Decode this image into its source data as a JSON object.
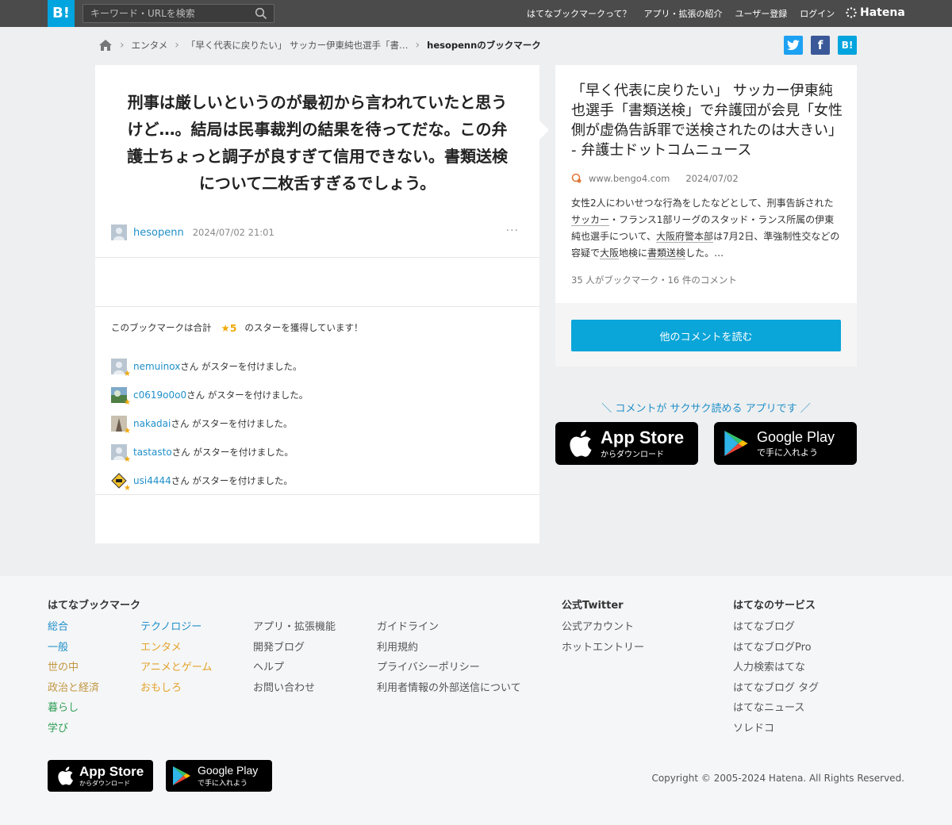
{
  "header": {
    "logo": "B!",
    "search_placeholder": "キーワード・URLを検索",
    "nav": [
      "はてなブックマークって？",
      "アプリ・拡張の紹介",
      "ユーザー登録",
      "ログイン"
    ],
    "brand": "Hatena"
  },
  "breadcrumb": {
    "items": [
      "エンタメ",
      "「早く代表に戻りたい」 サッカー伊東純也選手「書…"
    ],
    "current": "hesopennのブックマーク"
  },
  "share": {
    "facebook": "f",
    "hatena": "B!"
  },
  "bookmark": {
    "comment": "刑事は厳しいというのが最初から言われていたと思うけど…。結局は民事裁判の結果を待ってだな。この弁護士ちょっと調子が良すぎて信用できない。書類送検について二枚舌すぎるでしょう。",
    "user": "hesopenn",
    "timestamp": "2024/07/02 21:01",
    "more": "···"
  },
  "stars": {
    "summary_prefix": "このブックマークは合計",
    "total": "★5",
    "summary_suffix": "のスターを獲得しています！",
    "suffix": "さん がスターを付けました。",
    "users": [
      "nemuinox",
      "c0619o0o0",
      "nakadai",
      "tastasto",
      "usi4444"
    ]
  },
  "entry": {
    "title": "「早く代表に戻りたい」 サッカー伊東純也選手「書類送検」で弁護団が会見「女性側が虚偽告訴罪で送検されたのは大きい」 - 弁護士ドットコムニュース",
    "domain": "www.bengo4.com",
    "date": "2024/07/02",
    "body_parts": [
      "女性2人にわいせつな行為をしたなどとして、刑事告訴された",
      "サッカー",
      "・フランス1部リーグのスタッド・ランス所属の伊東純也選手について、",
      "大阪府警本部",
      "は7月2日、準強制性交などの容疑で",
      "大阪",
      "地検に",
      "書類送検",
      "した。…"
    ],
    "count": "35 人がブックマーク・16 件のコメント",
    "read_button": "他のコメントを読む"
  },
  "promo": {
    "text": "＼ コメントが サクサク読める アプリです ／",
    "appstore_big": "App Store",
    "appstore_small": "からダウンロード",
    "googleplay_big": "Google Play",
    "googleplay_small": "で手に入れよう"
  },
  "footer": {
    "col1_title": "はてなブックマーク",
    "col1a": [
      "総合",
      "一般",
      "世の中",
      "政治と経済",
      "暮らし",
      "学び"
    ],
    "col1b": [
      "テクノロジー",
      "エンタメ",
      "アニメとゲーム",
      "おもしろ"
    ],
    "col2": [
      "アプリ・拡張機能",
      "開発ブログ",
      "ヘルプ",
      "お問い合わせ"
    ],
    "col3": [
      "ガイドライン",
      "利用規約",
      "プライバシーポリシー",
      "利用者情報の外部送信について"
    ],
    "twitter_title": "公式Twitter",
    "twitter": [
      "公式アカウント",
      "ホットエントリー"
    ],
    "services_title": "はてなのサービス",
    "services": [
      "はてなブログ",
      "はてなブログPro",
      "人力検索はてな",
      "はてなブログ タグ",
      "はてなニュース",
      "ソレドコ"
    ],
    "copyright": "Copyright © 2005-2024 Hatena. All Rights Reserved."
  },
  "colors": {
    "accent": "#00a4de",
    "link": "#1f8fc9",
    "star": "#f0a90a",
    "col1a": [
      "#1f8fc9",
      "#1f8fc9",
      "#c29742",
      "#c29742",
      "#2f9e57",
      "#2f9e57"
    ],
    "col1b": [
      "#1f8fc9",
      "#e4a22a",
      "#e4a22a",
      "#e4a22a"
    ]
  }
}
